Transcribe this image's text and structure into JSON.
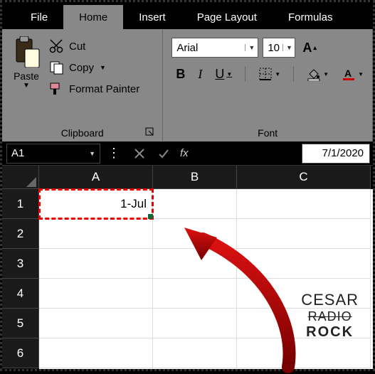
{
  "tabs": {
    "file": "File",
    "home": "Home",
    "insert": "Insert",
    "page_layout": "Page Layout",
    "formulas": "Formulas"
  },
  "active_tab": "Home",
  "clipboard": {
    "paste_label": "Paste",
    "cut_label": "Cut",
    "copy_label": "Copy",
    "format_painter_label": "Format Painter",
    "group_label": "Clipboard"
  },
  "font": {
    "name": "Arial",
    "size": "10",
    "bold_glyph": "B",
    "italic_glyph": "I",
    "underline_glyph": "U",
    "increase_glyph": "A",
    "group_label": "Font"
  },
  "namebox": {
    "value": "A1"
  },
  "formula_bar": {
    "fx_label": "fx",
    "value": "7/1/2020"
  },
  "grid": {
    "columns": [
      "A",
      "B",
      "C"
    ],
    "rows": [
      "1",
      "2",
      "3",
      "4",
      "5",
      "6"
    ],
    "selected_cell": "A1",
    "cells": {
      "A1": "1-Jul"
    }
  },
  "watermark": {
    "line1": "CESAR",
    "line2": "RADIO",
    "line3": "ROCK"
  }
}
